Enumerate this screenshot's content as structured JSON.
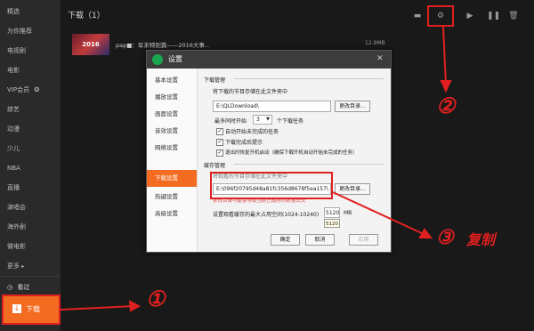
{
  "sidebar": {
    "items": [
      {
        "label": "精选"
      },
      {
        "label": "为你推荐"
      },
      {
        "label": "电视剧"
      },
      {
        "label": "电影"
      },
      {
        "label": "VIP会员"
      },
      {
        "label": "综艺"
      },
      {
        "label": "动漫"
      },
      {
        "label": "少儿"
      },
      {
        "label": "NBA"
      },
      {
        "label": "直播"
      },
      {
        "label": "演唱会"
      },
      {
        "label": "海外剧"
      },
      {
        "label": "微电影"
      },
      {
        "label": "更多"
      }
    ],
    "history_label": "看过",
    "download_label": "下载"
  },
  "main": {
    "title": "下载（1）",
    "download_item": {
      "title": "pap■：年末特别篇——2016大事...",
      "size": "12.9MB",
      "thumb_text": "2016"
    }
  },
  "dialog": {
    "title": "设置",
    "nav": [
      {
        "label": "基本设置"
      },
      {
        "label": "播放设置"
      },
      {
        "label": "画面设置"
      },
      {
        "label": "音效设置"
      },
      {
        "label": "网络设置"
      },
      {
        "label": "下载设置"
      },
      {
        "label": "热键设置"
      },
      {
        "label": "高级设置"
      }
    ],
    "download_mgmt": {
      "section_title": "下载管理",
      "path_label": "将下载的节目存储在此文件夹中",
      "path_value": "E:\\QLDownload\\",
      "change_dir_button": "更改目录...",
      "max_tasks_prefix": "最多同时开始",
      "max_tasks_value": "3",
      "max_tasks_suffix": "个下载任务",
      "options": [
        {
          "label": "自动开始未完成的任务",
          "checked": true
        },
        {
          "label": "下载完成后提示",
          "checked": true
        },
        {
          "label": "退出时恢复开机启动（确保下载开机自动开始未完成的任务）",
          "checked": true
        }
      ]
    },
    "cache_mgmt": {
      "section_title": "缓存管理",
      "path_label": "将观看的节目存储在此文件夹中",
      "path_value": "E:\\096f20795d48a81fc356d8678f5ea157\\",
      "change_dir_button": "更改目录...",
      "warning_text": "更改目录可能会导致当前已缓存的数据丢失",
      "max_space_label": "设置观看缓存的最大占用空间(1024-10240)",
      "max_space_value": "5120",
      "max_space_unit": "MB",
      "tooltip_value": "5120"
    },
    "buttons": {
      "ok": "确定",
      "cancel": "取消",
      "apply": "应用"
    }
  },
  "annotations": {
    "one": "①",
    "two": "②",
    "three": "③",
    "copy_text": "复制"
  },
  "colors": {
    "accent": "#f36c21",
    "annotation_red": "#e02020",
    "sidebar_bg": "#2a2a2a",
    "main_bg": "#191919"
  }
}
